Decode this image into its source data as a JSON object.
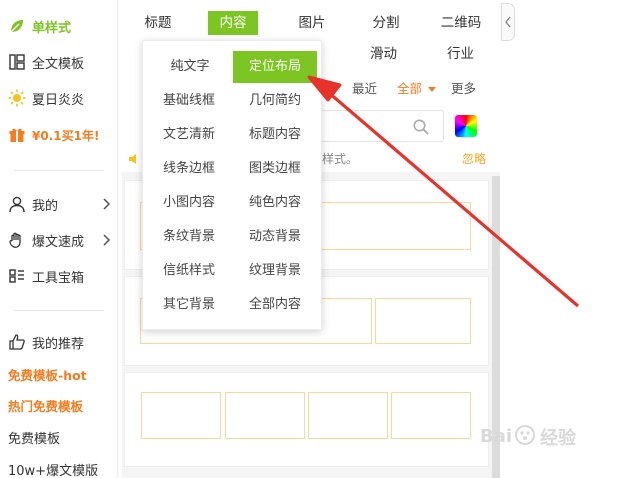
{
  "sidebar": {
    "items": [
      {
        "label": "单样式"
      },
      {
        "label": "全文模板"
      },
      {
        "label": "夏日炎炎"
      },
      {
        "label": "¥0.1买1年!"
      },
      {
        "label": "我的"
      },
      {
        "label": "爆文速成"
      },
      {
        "label": "工具宝箱"
      },
      {
        "label": "我的推荐"
      },
      {
        "label": "免费模板-hot"
      },
      {
        "label": "热门免费模板"
      },
      {
        "label": "免费模板"
      },
      {
        "label": "10w+爆文模版"
      }
    ]
  },
  "topnav": {
    "tabs": [
      {
        "label": "标题"
      },
      {
        "label": "内容"
      },
      {
        "label": "图片"
      },
      {
        "label": "分割"
      },
      {
        "label": "二维码"
      }
    ],
    "row2": [
      {
        "label": "滑动"
      },
      {
        "label": "行业"
      }
    ]
  },
  "filter": {
    "recent": "最近",
    "all": "全部",
    "more": "更多"
  },
  "notice": {
    "text": "样式。",
    "ignore": "忽略"
  },
  "dropdown": {
    "items": [
      {
        "label": "纯文字"
      },
      {
        "label": "定位布局"
      },
      {
        "label": "基础线框"
      },
      {
        "label": "几何简约"
      },
      {
        "label": "文艺清新"
      },
      {
        "label": "标题内容"
      },
      {
        "label": "线条边框"
      },
      {
        "label": "图类边框"
      },
      {
        "label": "小图内容"
      },
      {
        "label": "纯色内容"
      },
      {
        "label": "条纹背景"
      },
      {
        "label": "动态背景"
      },
      {
        "label": "信纸样式"
      },
      {
        "label": "纹理背景"
      },
      {
        "label": "其它背景"
      },
      {
        "label": "全部内容"
      }
    ],
    "selected": "定位布局"
  },
  "watermark": {
    "text": "经验"
  },
  "colors": {
    "accent": "#7cc522",
    "orange": "#f57c1f",
    "arrow": "#e8332a",
    "slot_border": "#fcd79b"
  }
}
